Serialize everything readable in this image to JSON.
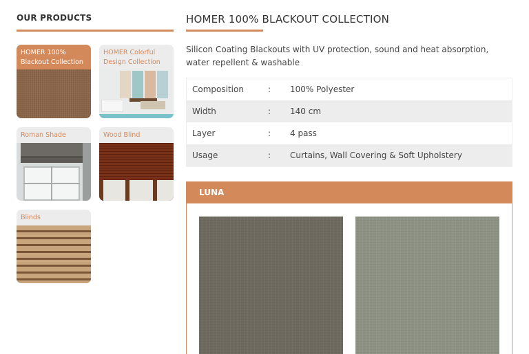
{
  "sidebar": {
    "title": "OUR PRODUCTS",
    "products": [
      {
        "label": "HOMER 100% Blackout Collection",
        "active": true
      },
      {
        "label": "HOMER Colorful Design Collection",
        "active": false
      },
      {
        "label": "Roman Shade",
        "active": false
      },
      {
        "label": "Wood Blind",
        "active": false
      },
      {
        "label": "Blinds",
        "active": false
      }
    ]
  },
  "main": {
    "title": "HOMER 100% BLACKOUT COLLECTION",
    "description": "Silicon Coating Blackouts with UV protection, sound and heat absorption, water repellent & washable",
    "specs": [
      {
        "key": "Composition",
        "sep": ":",
        "value": "100% Polyester"
      },
      {
        "key": "Width",
        "sep": ":",
        "value": "140 cm"
      },
      {
        "key": "Layer",
        "sep": ":",
        "value": "4 pass"
      },
      {
        "key": "Usage",
        "sep": ":",
        "value": "Curtains, Wall Covering & Soft Upholstery"
      }
    ],
    "variant": {
      "name": "LUNA",
      "swatches": [
        {
          "color": "#6f6a5f"
        },
        {
          "color": "#8e9284"
        }
      ]
    }
  },
  "colors": {
    "accent": "#d4895a",
    "text": "#333333",
    "row_alt": "#ededed"
  }
}
